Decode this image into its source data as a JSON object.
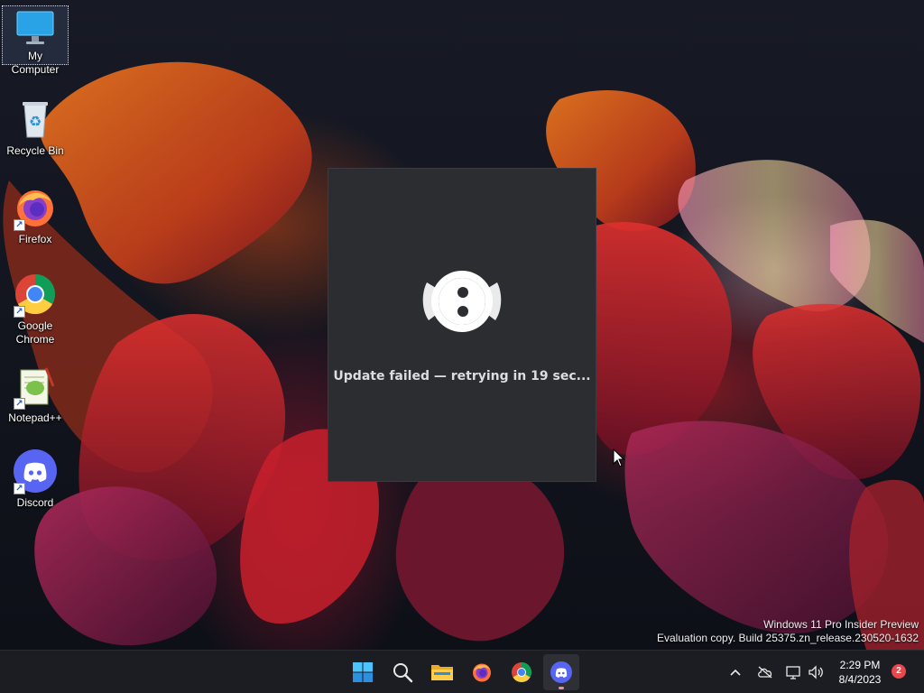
{
  "desktop": {
    "icons": [
      {
        "label": "My Computer",
        "icon": "monitor-icon",
        "selected": true
      },
      {
        "label": "Recycle Bin",
        "icon": "recycle-bin-icon"
      },
      {
        "label": "Firefox",
        "icon": "firefox-icon",
        "shortcut": true
      },
      {
        "label": "Google Chrome",
        "icon": "chrome-icon",
        "shortcut": true
      },
      {
        "label": "Notepad++",
        "icon": "notepadpp-icon",
        "shortcut": true
      },
      {
        "label": "Discord",
        "icon": "discord-icon",
        "shortcut": true
      }
    ]
  },
  "updater": {
    "status": "Update failed — retrying in 19 sec..."
  },
  "watermark": {
    "line1": "Windows 11 Pro Insider Preview",
    "line2": "Evaluation copy. Build 25375.zn_release.230520-1632"
  },
  "taskbar": {
    "apps": [
      {
        "name": "start",
        "icon": "windows-start-icon"
      },
      {
        "name": "search",
        "icon": "search-icon"
      },
      {
        "name": "file-explorer",
        "icon": "folder-icon"
      },
      {
        "name": "firefox",
        "icon": "firefox-icon"
      },
      {
        "name": "chrome",
        "icon": "chrome-icon"
      },
      {
        "name": "discord",
        "icon": "discord-icon",
        "active": true
      }
    ],
    "tray": {
      "time": "2:29 PM",
      "date": "8/4/2023",
      "notification_count": "2"
    }
  },
  "colors": {
    "discord_blurple": "#5865f2",
    "updater_bg": "#2b2d31",
    "taskbar_bg": "#1c1d22"
  }
}
